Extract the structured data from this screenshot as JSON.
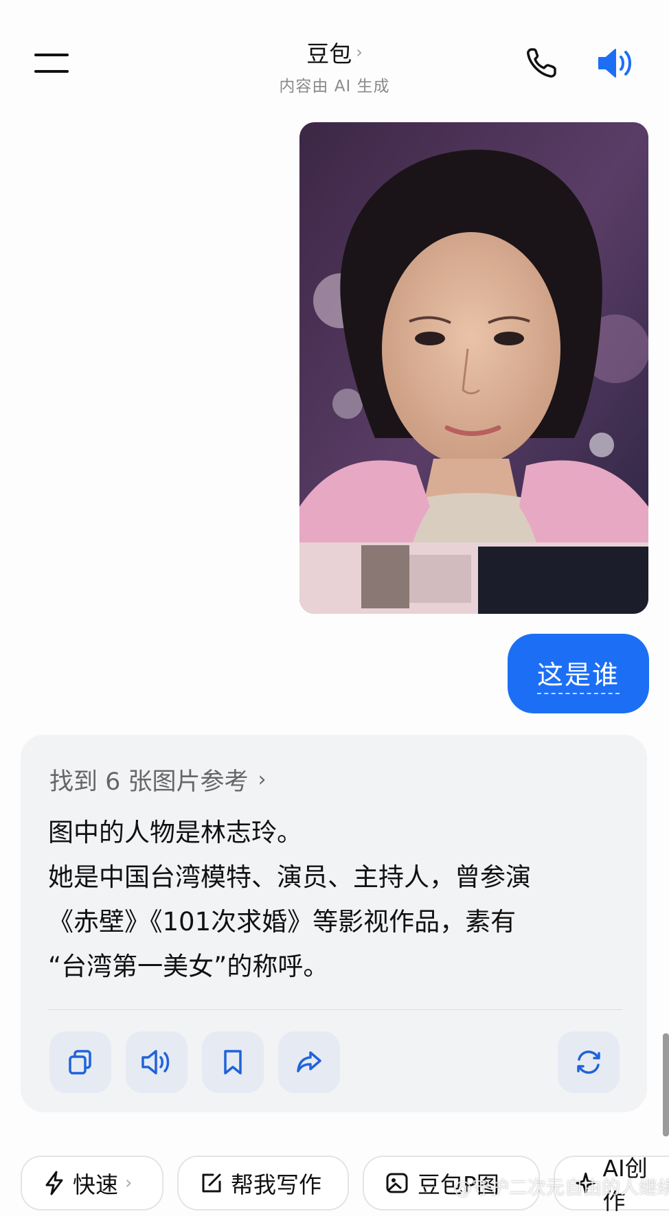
{
  "header": {
    "title": "豆包",
    "title_chevron": "›",
    "subtitle": "内容由 AI 生成",
    "icons": [
      "menu-icon",
      "phone-icon",
      "speaker-icon"
    ]
  },
  "user_message": {
    "image": "selfie-photo",
    "text": "这是谁"
  },
  "ai_reply": {
    "refs_label": "找到 6 张图片参考",
    "refs_arrow": "›",
    "lines": [
      "图中的人物是林志玲。",
      "她是中国台湾模特、演员、主持人，曾参演",
      "《赤壁》《101次求婚》等影视作品，素有",
      "“台湾第一美女”的称呼。"
    ],
    "actions": [
      "copy-icon",
      "speak-icon",
      "bookmark-icon",
      "share-icon",
      "regenerate-icon"
    ]
  },
  "chips": [
    {
      "label": "快速",
      "chevron": "›"
    },
    {
      "label": "帮我写作"
    },
    {
      "label": "豆包P图"
    },
    {
      "label": "AI创作"
    }
  ],
  "watermark": "@守护二次元自由的人继续",
  "colors": {
    "accent": "#1c6ff5",
    "card_bg": "#f2f3f5",
    "action_bg": "#e6eaf3",
    "icon_blue": "#1f63d9"
  }
}
